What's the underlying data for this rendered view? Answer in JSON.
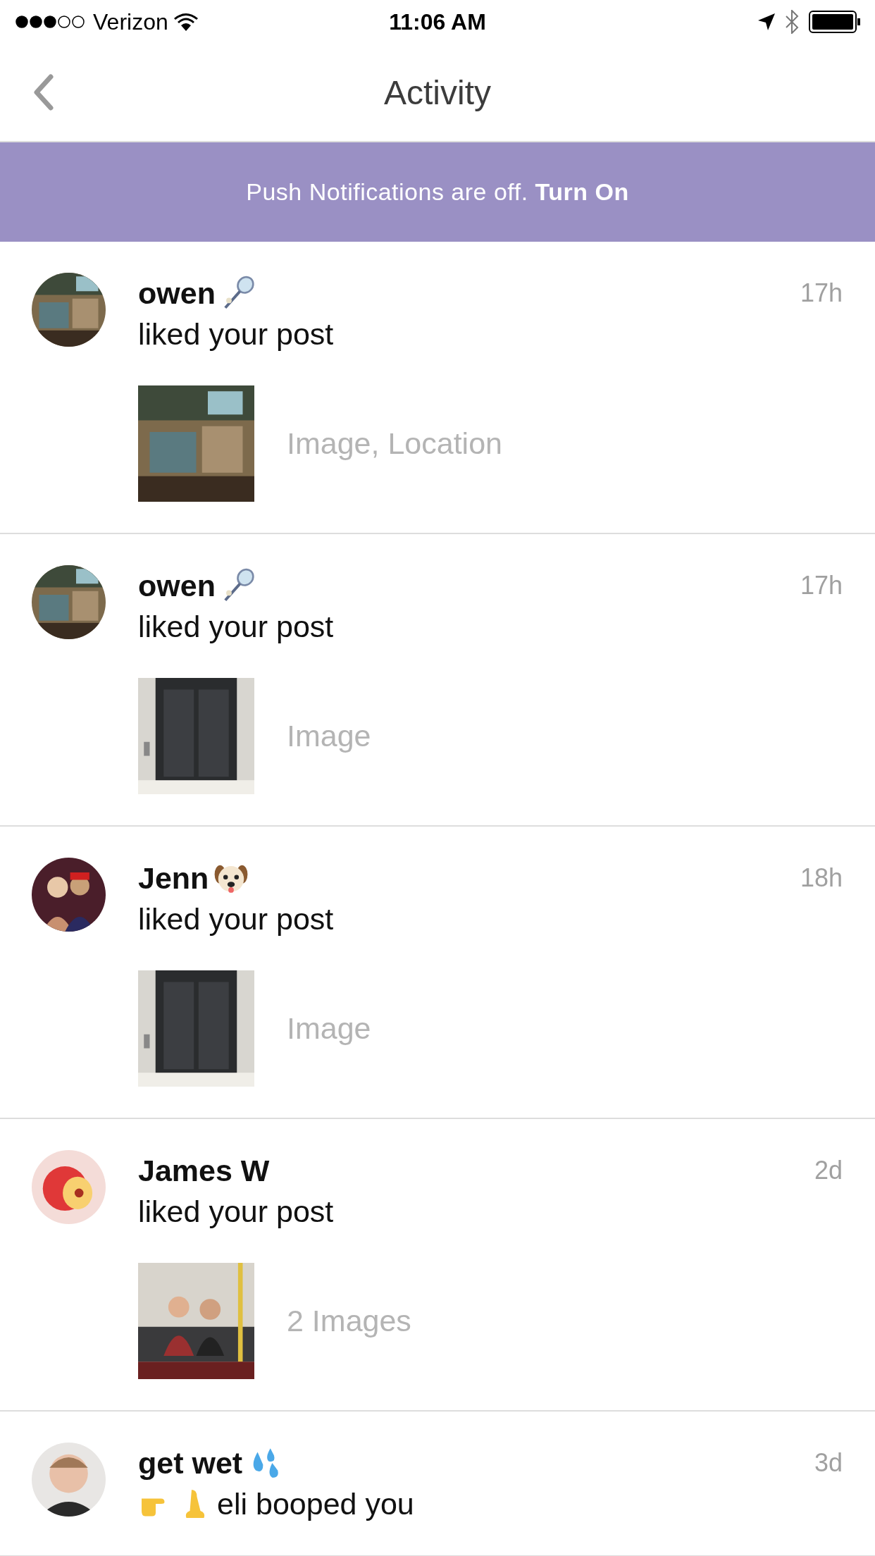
{
  "status_bar": {
    "carrier": "Verizon",
    "time": "11:06 AM"
  },
  "nav": {
    "title": "Activity"
  },
  "banner": {
    "text": "Push Notifications are off. **Turn On**"
  },
  "activities": [
    {
      "name": "owen",
      "name_icon": {
        "kind": "racket"
      },
      "action": "liked your post",
      "time": "17h",
      "caption": "Image, Location"
    },
    {
      "name": "owen",
      "name_icon": {
        "kind": "racket"
      },
      "action": "liked your post",
      "time": "17h",
      "caption": "Image"
    },
    {
      "name": "Jenn",
      "name_icon": {
        "kind": "dog"
      },
      "action": "liked your post",
      "time": "18h",
      "caption": "Image"
    },
    {
      "name": "James W",
      "action": "liked your post",
      "time": "2d",
      "caption": "2 Images"
    },
    {
      "name": "get wet",
      "name_icon": {
        "kind": "drops"
      },
      "action_icons": [
        {
          "kind": "hand"
        },
        {
          "kind": "nose"
        }
      ],
      "action": "eli booped you",
      "time": "3d"
    }
  ]
}
